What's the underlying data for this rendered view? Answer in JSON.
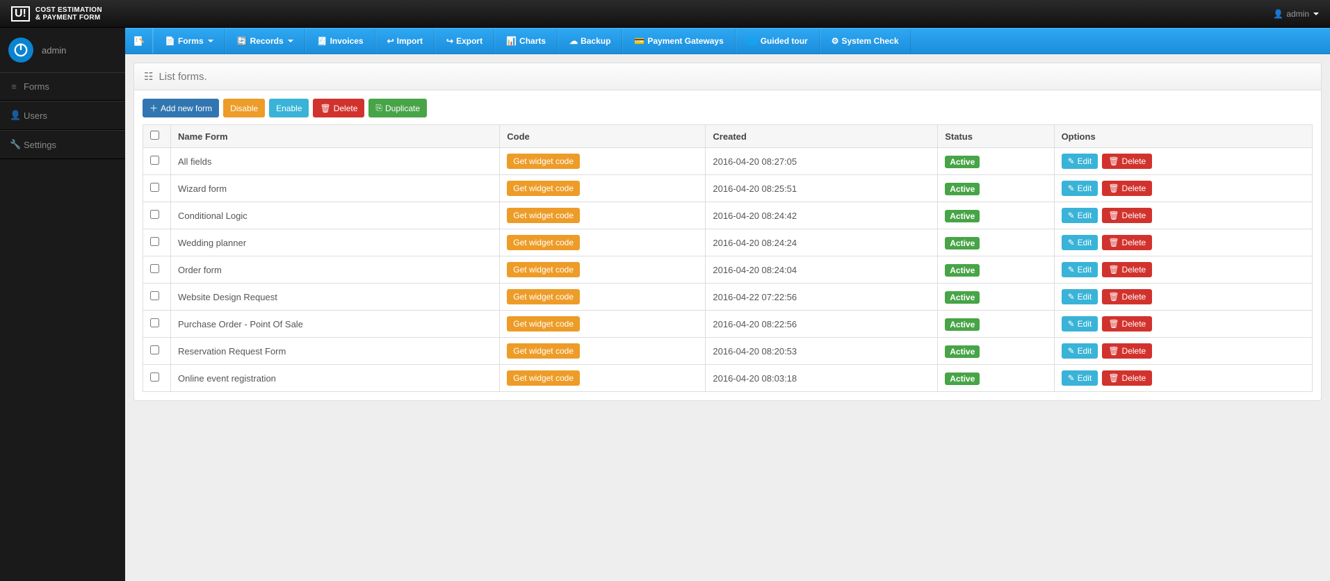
{
  "brand": {
    "logo": "U!",
    "line1": "COST ESTIMATION",
    "line2": "& PAYMENT FORM"
  },
  "topbar": {
    "user_label": "admin"
  },
  "sidebar": {
    "username": "admin",
    "items": [
      {
        "label": "Forms"
      },
      {
        "label": "Users"
      },
      {
        "label": "Settings"
      }
    ]
  },
  "toolbar": {
    "items": [
      {
        "label": "Forms",
        "caret": true
      },
      {
        "label": "Records",
        "caret": true
      },
      {
        "label": "Invoices"
      },
      {
        "label": "Import"
      },
      {
        "label": "Export"
      },
      {
        "label": "Charts"
      },
      {
        "label": "Backup"
      },
      {
        "label": "Payment Gateways"
      },
      {
        "label": "Guided tour"
      },
      {
        "label": "System Check"
      }
    ]
  },
  "panel": {
    "title": "List forms."
  },
  "actions": {
    "add": "Add new form",
    "disable": "Disable",
    "enable": "Enable",
    "delete": "Delete",
    "duplicate": "Duplicate"
  },
  "table": {
    "headers": {
      "name": "Name Form",
      "code": "Code",
      "created": "Created",
      "status": "Status",
      "options": "Options"
    },
    "code_button": "Get widget code",
    "edit_label": "Edit",
    "delete_label": "Delete",
    "rows": [
      {
        "name": "All fields",
        "created": "2016-04-20 08:27:05",
        "status": "Active"
      },
      {
        "name": "Wizard form",
        "created": "2016-04-20 08:25:51",
        "status": "Active"
      },
      {
        "name": "Conditional Logic",
        "created": "2016-04-20 08:24:42",
        "status": "Active"
      },
      {
        "name": "Wedding planner",
        "created": "2016-04-20 08:24:24",
        "status": "Active"
      },
      {
        "name": "Order form",
        "created": "2016-04-20 08:24:04",
        "status": "Active"
      },
      {
        "name": "Website Design Request",
        "created": "2016-04-22 07:22:56",
        "status": "Active"
      },
      {
        "name": "Purchase Order - Point Of Sale",
        "created": "2016-04-20 08:22:56",
        "status": "Active"
      },
      {
        "name": "Reservation Request Form",
        "created": "2016-04-20 08:20:53",
        "status": "Active"
      },
      {
        "name": "Online event registration",
        "created": "2016-04-20 08:03:18",
        "status": "Active"
      }
    ]
  }
}
